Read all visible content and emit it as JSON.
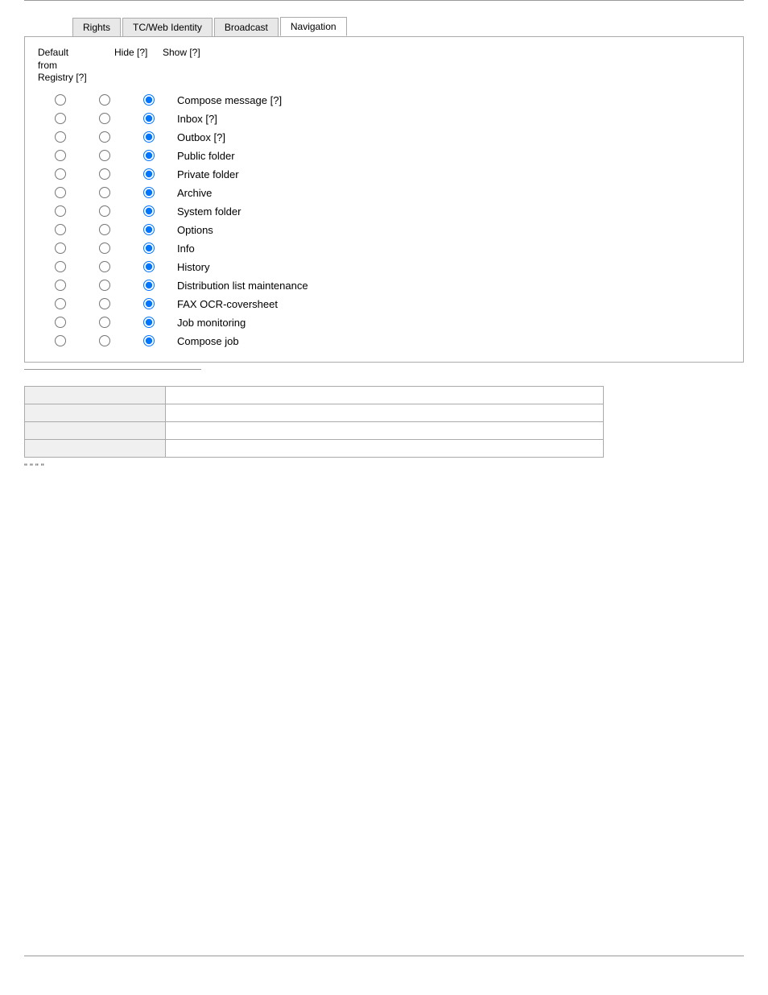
{
  "tabs": [
    {
      "id": "rights",
      "label": "Rights",
      "active": false
    },
    {
      "id": "tcweb",
      "label": "TC/Web Identity",
      "active": false
    },
    {
      "id": "broadcast",
      "label": "Broadcast",
      "active": false
    },
    {
      "id": "navigation",
      "label": "Navigation",
      "active": true
    }
  ],
  "header": {
    "default_label": "Default from Registry [?]",
    "hide_label": "Hide [?]",
    "show_label": "Show [?]"
  },
  "nav_items": [
    {
      "id": 1,
      "label": "Compose message [?]",
      "selected": "registry"
    },
    {
      "id": 2,
      "label": "Inbox [?]",
      "selected": "registry"
    },
    {
      "id": 3,
      "label": "Outbox [?]",
      "selected": "registry"
    },
    {
      "id": 4,
      "label": "Public folder",
      "selected": "registry"
    },
    {
      "id": 5,
      "label": "Private folder",
      "selected": "registry"
    },
    {
      "id": 6,
      "label": "Archive",
      "selected": "registry"
    },
    {
      "id": 7,
      "label": "System folder",
      "selected": "registry"
    },
    {
      "id": 8,
      "label": "Options",
      "selected": "registry"
    },
    {
      "id": 9,
      "label": "Info",
      "selected": "registry"
    },
    {
      "id": 10,
      "label": "History",
      "selected": "registry"
    },
    {
      "id": 11,
      "label": "Distribution list maintenance",
      "selected": "registry"
    },
    {
      "id": 12,
      "label": "FAX OCR-coversheet",
      "selected": "registry"
    },
    {
      "id": 13,
      "label": "Job monitoring",
      "selected": "registry"
    },
    {
      "id": 14,
      "label": "Compose job",
      "selected": "registry"
    }
  ],
  "table": {
    "rows": [
      {
        "col1": "",
        "col2": ""
      },
      {
        "col1": "",
        "col2": ""
      },
      {
        "col1": "",
        "col2": ""
      },
      {
        "col1": "",
        "col2": ""
      }
    ]
  },
  "footer_note": "\" \"                       \" \""
}
